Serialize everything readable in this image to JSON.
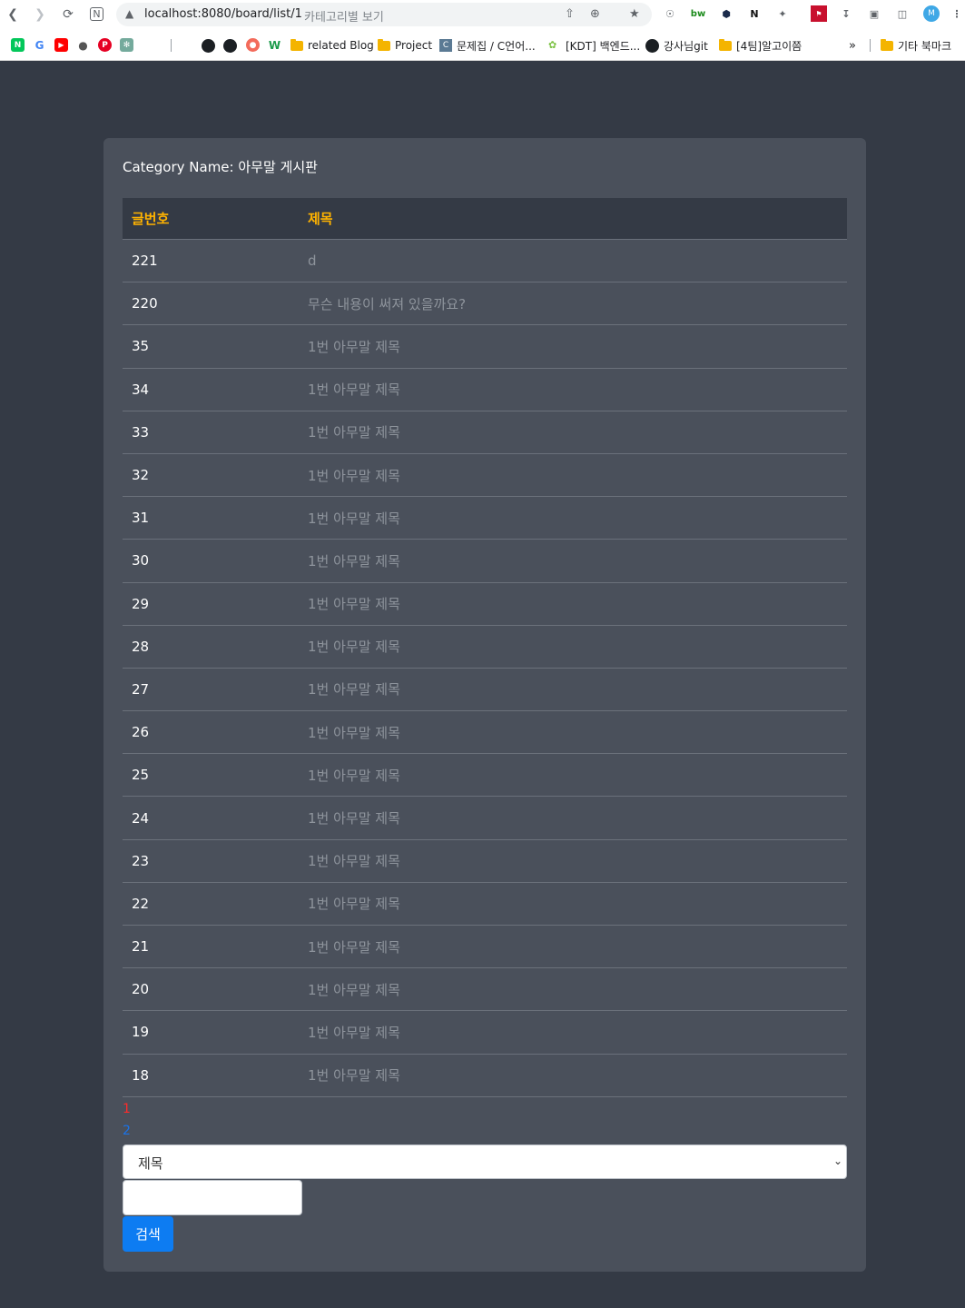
{
  "browser": {
    "url": "localhost:8080/board/list/1",
    "page_title": "카테고리별 보기",
    "profile_initial": "M",
    "bookmarks": [
      {
        "label": "related Blog",
        "type": "folder"
      },
      {
        "label": "Project",
        "type": "folder"
      },
      {
        "label": "문제집 / C언어...",
        "type": "site"
      },
      {
        "label": "[KDT] 백엔드...",
        "type": "site"
      },
      {
        "label": "강사님git",
        "type": "github"
      },
      {
        "label": "[4팀]알고이쯤",
        "type": "folder"
      },
      {
        "label": "기타 북마크",
        "type": "folder"
      }
    ],
    "more": "»"
  },
  "board": {
    "category_label": "Category Name: 아무말 게시판",
    "headers": {
      "num": "글번호",
      "title": "제목"
    },
    "rows": [
      {
        "num": "221",
        "title": "d"
      },
      {
        "num": "220",
        "title": "무슨 내용이 써져 있을까요?"
      },
      {
        "num": "35",
        "title": "1번 아무말 제목"
      },
      {
        "num": "34",
        "title": "1번 아무말 제목"
      },
      {
        "num": "33",
        "title": "1번 아무말 제목"
      },
      {
        "num": "32",
        "title": "1번 아무말 제목"
      },
      {
        "num": "31",
        "title": "1번 아무말 제목"
      },
      {
        "num": "30",
        "title": "1번 아무말 제목"
      },
      {
        "num": "29",
        "title": "1번 아무말 제목"
      },
      {
        "num": "28",
        "title": "1번 아무말 제목"
      },
      {
        "num": "27",
        "title": "1번 아무말 제목"
      },
      {
        "num": "26",
        "title": "1번 아무말 제목"
      },
      {
        "num": "25",
        "title": "1번 아무말 제목"
      },
      {
        "num": "24",
        "title": "1번 아무말 제목"
      },
      {
        "num": "23",
        "title": "1번 아무말 제목"
      },
      {
        "num": "22",
        "title": "1번 아무말 제목"
      },
      {
        "num": "21",
        "title": "1번 아무말 제목"
      },
      {
        "num": "20",
        "title": "1번 아무말 제목"
      },
      {
        "num": "19",
        "title": "1번 아무말 제목"
      },
      {
        "num": "18",
        "title": "1번 아무말 제목"
      }
    ],
    "pages": [
      {
        "label": "1",
        "active": true
      },
      {
        "label": "2",
        "active": false
      }
    ]
  },
  "search": {
    "select_value": "제목",
    "input_value": "",
    "button_label": "검색"
  },
  "colors": {
    "page_bg": "#343a45",
    "card_bg": "#4a505b",
    "header_text": "#ffb300",
    "active_page": "#ff2a2a",
    "link_page": "#1a73e8",
    "button": "#0d7cf2"
  }
}
